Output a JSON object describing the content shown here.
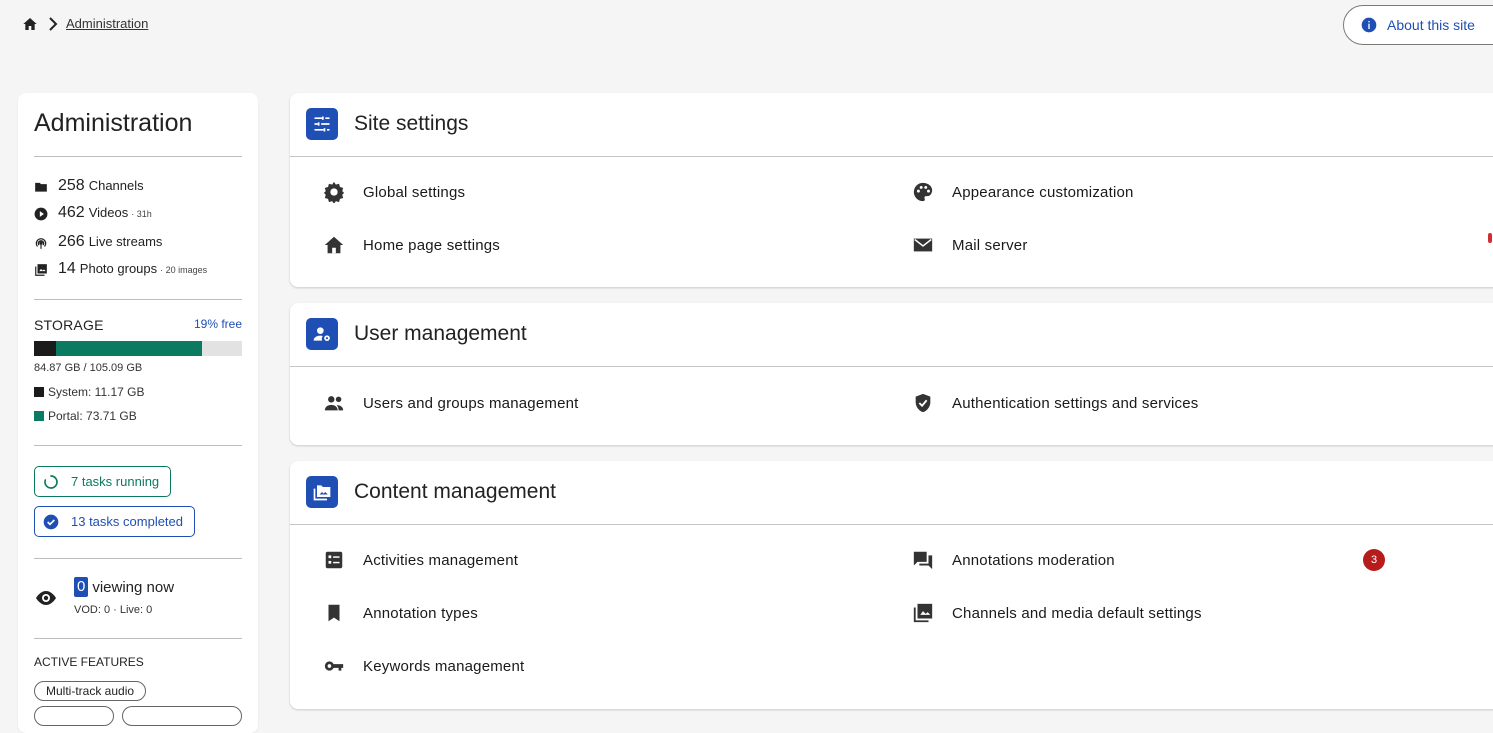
{
  "breadcrumb": {
    "current": "Administration"
  },
  "about_button": {
    "label": "About this site"
  },
  "sidebar": {
    "title": "Administration",
    "stats": [
      {
        "icon": "folder-icon",
        "count": "258",
        "label": "Channels",
        "sub": ""
      },
      {
        "icon": "play-circle-icon",
        "count": "462",
        "label": "Videos",
        "sub": "· 31h"
      },
      {
        "icon": "live-stream-icon",
        "count": "266",
        "label": "Live streams",
        "sub": ""
      },
      {
        "icon": "photo-library-icon",
        "count": "14",
        "label": "Photo groups",
        "sub": "· 20 images"
      }
    ],
    "storage": {
      "title": "STORAGE",
      "free_label": "19% free",
      "used_label": "84.87 GB / 105.09 GB",
      "system_fraction": 0.106,
      "portal_fraction": 0.701,
      "system_label": "System: 11.17 GB",
      "portal_label": "Portal: 73.71 GB",
      "system_color": "#1b1b1b",
      "portal_color": "#0a7a60"
    },
    "tasks": {
      "running_label": "7 tasks running",
      "completed_label": "13 tasks completed"
    },
    "viewing": {
      "count": "0",
      "label": "viewing now",
      "sub": "VOD: 0 · Live: 0"
    },
    "features": {
      "title": "ACTIVE FEATURES",
      "items": [
        "Multi-track audio"
      ]
    }
  },
  "sections": {
    "site_settings": {
      "title": "Site settings",
      "items": {
        "global": "Global settings",
        "appearance": "Appearance customization",
        "home": "Home page settings",
        "mail": "Mail server"
      }
    },
    "user_management": {
      "title": "User management",
      "items": {
        "users": "Users and groups management",
        "auth": "Authentication settings and services"
      }
    },
    "content_management": {
      "title": "Content management",
      "items": {
        "activities": "Activities management",
        "annotations_moderation": "Annotations moderation",
        "annotations_badge": "3",
        "annotation_types": "Annotation types",
        "channels_defaults": "Channels and media default settings",
        "keywords": "Keywords management"
      }
    }
  },
  "colors": {
    "accent": "#1f4fb4",
    "success": "#0a7a60",
    "danger": "#b71c1c"
  }
}
